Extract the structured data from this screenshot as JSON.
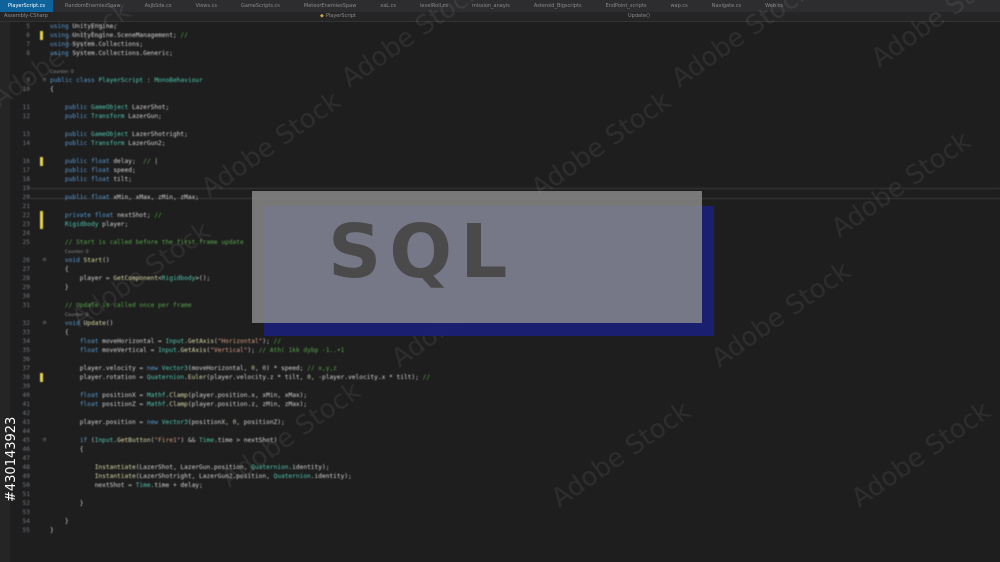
{
  "tabs": [
    {
      "label": "PlayerScript.cs",
      "active": true
    },
    {
      "label": "RandomEnemiesSpaw",
      "active": false
    },
    {
      "label": "AsjbSde.cs",
      "active": false
    },
    {
      "label": "Views.cs",
      "active": false
    },
    {
      "label": "GameScripts.cs",
      "active": false
    },
    {
      "label": "MeteorEnemiesSpaw",
      "active": false
    },
    {
      "label": "xaL.cs",
      "active": false
    },
    {
      "label": "levelRoll.cs",
      "active": false
    },
    {
      "label": "mission_anayis",
      "active": false
    },
    {
      "label": "Asteroid_Bigscripts",
      "active": false
    },
    {
      "label": "EndPoint_scripts",
      "active": false
    },
    {
      "label": "wap.cs",
      "active": false
    },
    {
      "label": "Navigate.cs",
      "active": false
    },
    {
      "label": "Web.cs",
      "active": false
    }
  ],
  "nav": {
    "left": "Assembly-CSharp",
    "middle": "PlayerScript",
    "right": "Update()"
  },
  "code_lines": [
    {
      "n": "5",
      "html": "<span class='kw'>using</span> UnityEngine;"
    },
    {
      "n": "6",
      "html": "<span class='kw'>using</span> UnityEngine.SceneManagement; <span class='cm'>//</span>",
      "mark": true
    },
    {
      "n": "7",
      "html": "<span class='kw'>using</span> System.Collections;"
    },
    {
      "n": "8",
      "html": "<span class='kw'>using</span> System.Collections.Generic;"
    },
    {
      "n": "",
      "html": ""
    },
    {
      "n": "",
      "html": "<span class='codelens'>Counter: 0</span>"
    },
    {
      "n": "9",
      "html": "<span class='kw'>public class</span> <span class='ty'>PlayerScript</span> : <span class='ty'>MonoBehaviour</span>",
      "fold": true
    },
    {
      "n": "10",
      "html": "{"
    },
    {
      "n": "",
      "html": ""
    },
    {
      "n": "11",
      "html": "    <span class='kw'>public</span> <span class='ty'>GameObject</span> LazerShot;"
    },
    {
      "n": "12",
      "html": "    <span class='kw'>public</span> <span class='ty'>Transform</span> LazerGun;"
    },
    {
      "n": "",
      "html": ""
    },
    {
      "n": "13",
      "html": "    <span class='kw'>public</span> <span class='ty'>GameObject</span> LazerShotright;"
    },
    {
      "n": "14",
      "html": "    <span class='kw'>public</span> <span class='ty'>Transform</span> LazerGun2;"
    },
    {
      "n": "",
      "html": ""
    },
    {
      "n": "16",
      "html": "    <span class='kw'>public float</span> delay;  <span class='cm'>//</span> |",
      "mark": true
    },
    {
      "n": "17",
      "html": "    <span class='kw'>public float</span> speed;"
    },
    {
      "n": "18",
      "html": "    <span class='kw'>public float</span> tilt;"
    },
    {
      "n": "19",
      "html": ""
    },
    {
      "n": "20",
      "html": "    <span class='kw'>public float</span> xMin, xMax, zMin, zMax;"
    },
    {
      "n": "21",
      "html": ""
    },
    {
      "n": "22",
      "html": "    <span class='kw'>private float</span> nextShot; <span class='cm'>//</span>",
      "mark": true
    },
    {
      "n": "23",
      "html": "    <span class='ty'>Rigidbody</span> player;",
      "mark": true
    },
    {
      "n": "24",
      "html": ""
    },
    {
      "n": "25",
      "html": "    <span class='cm'>// Start is called before the first frame update</span>"
    },
    {
      "n": "",
      "html": "    <span class='codelens'>Counter: 0</span>"
    },
    {
      "n": "26",
      "html": "    <span class='kw'>void</span> <span class='fn'>Start</span>()",
      "fold": true
    },
    {
      "n": "27",
      "html": "    {"
    },
    {
      "n": "28",
      "html": "        player = <span class='fn'>GetComponent</span>&lt;<span class='ty'>Rigidbody</span>&gt;();"
    },
    {
      "n": "29",
      "html": "    }"
    },
    {
      "n": "30",
      "html": ""
    },
    {
      "n": "31",
      "html": "    <span class='cm'>// Update is called once per frame</span>"
    },
    {
      "n": "",
      "html": "    <span class='codelens'>Counter: 0</span>"
    },
    {
      "n": "32",
      "html": "    <span class='kw'>void</span> <span class='fn'>Update</span>()",
      "fold": true
    },
    {
      "n": "33",
      "html": "    {"
    },
    {
      "n": "34",
      "html": "        <span class='kw'>float</span> moveHorizontal = <span class='ty'>Input</span>.<span class='fn'>GetAxis</span>(<span class='st'>\"Horizontal\"</span>); <span class='cm'>//</span>"
    },
    {
      "n": "35",
      "html": "        <span class='kw'>float</span> moveVertical = <span class='ty'>Input</span>.<span class='fn'>GetAxis</span>(<span class='st'>\"Vertical\"</span>); <span class='cm'>// Ath( 1kk dybp -1..+1</span>"
    },
    {
      "n": "36",
      "html": ""
    },
    {
      "n": "37",
      "html": "        player.velocity = <span class='kw'>new</span> <span class='ty'>Vector3</span>(moveHorizontal, <span class='nu'>0</span>, <span class='nu'>0</span>) * speed; <span class='cm'>// x,y,z</span>"
    },
    {
      "n": "38",
      "html": "        player.rotation = <span class='ty'>Quaternion</span>.<span class='fn'>Euler</span>(player.velocity.z * tilt, <span class='nu'>0</span>, -player.velocity.x * tilt); <span class='cm'>//</span>",
      "mark": true
    },
    {
      "n": "39",
      "html": ""
    },
    {
      "n": "40",
      "html": "        <span class='kw'>float</span> positionX = <span class='ty'>Mathf</span>.<span class='fn'>Clamp</span>(player.position.x, xMin, xMax);"
    },
    {
      "n": "41",
      "html": "        <span class='kw'>float</span> positionZ = <span class='ty'>Mathf</span>.<span class='fn'>Clamp</span>(player.position.z, zMin, zMax);"
    },
    {
      "n": "42",
      "html": ""
    },
    {
      "n": "43",
      "html": "        player.position = <span class='kw'>new</span> <span class='ty'>Vector3</span>(positionX, <span class='nu'>0</span>, positionZ);"
    },
    {
      "n": "44",
      "html": ""
    },
    {
      "n": "45",
      "html": "        <span class='kw'>if</span> (<span class='ty'>Input</span>.<span class='fn'>GetButton</span>(<span class='st'>\"Fire1\"</span>) &amp;&amp; <span class='ty'>Time</span>.time &gt; nextShot)",
      "fold": true
    },
    {
      "n": "46",
      "html": "        {"
    },
    {
      "n": "47",
      "html": ""
    },
    {
      "n": "48",
      "html": "            <span class='fn'>Instantiate</span>(LazerShot, LazerGun.position, <span class='ty'>Quaternion</span>.identity);"
    },
    {
      "n": "49",
      "html": "            <span class='fn'>Instantiate</span>(LazerShotright, LazerGun2.position, <span class='ty'>Quaternion</span>.identity);"
    },
    {
      "n": "50",
      "html": "            nextShot = <span class='ty'>Time</span>.time + delay;"
    },
    {
      "n": "51",
      "html": ""
    },
    {
      "n": "52",
      "html": "        }"
    },
    {
      "n": "53",
      "html": ""
    },
    {
      "n": "54",
      "html": "    }"
    },
    {
      "n": "55",
      "html": "}"
    }
  ],
  "overlay": {
    "title": "SQL"
  },
  "watermark": "Adobe Stock",
  "stock_id": "#430143923"
}
